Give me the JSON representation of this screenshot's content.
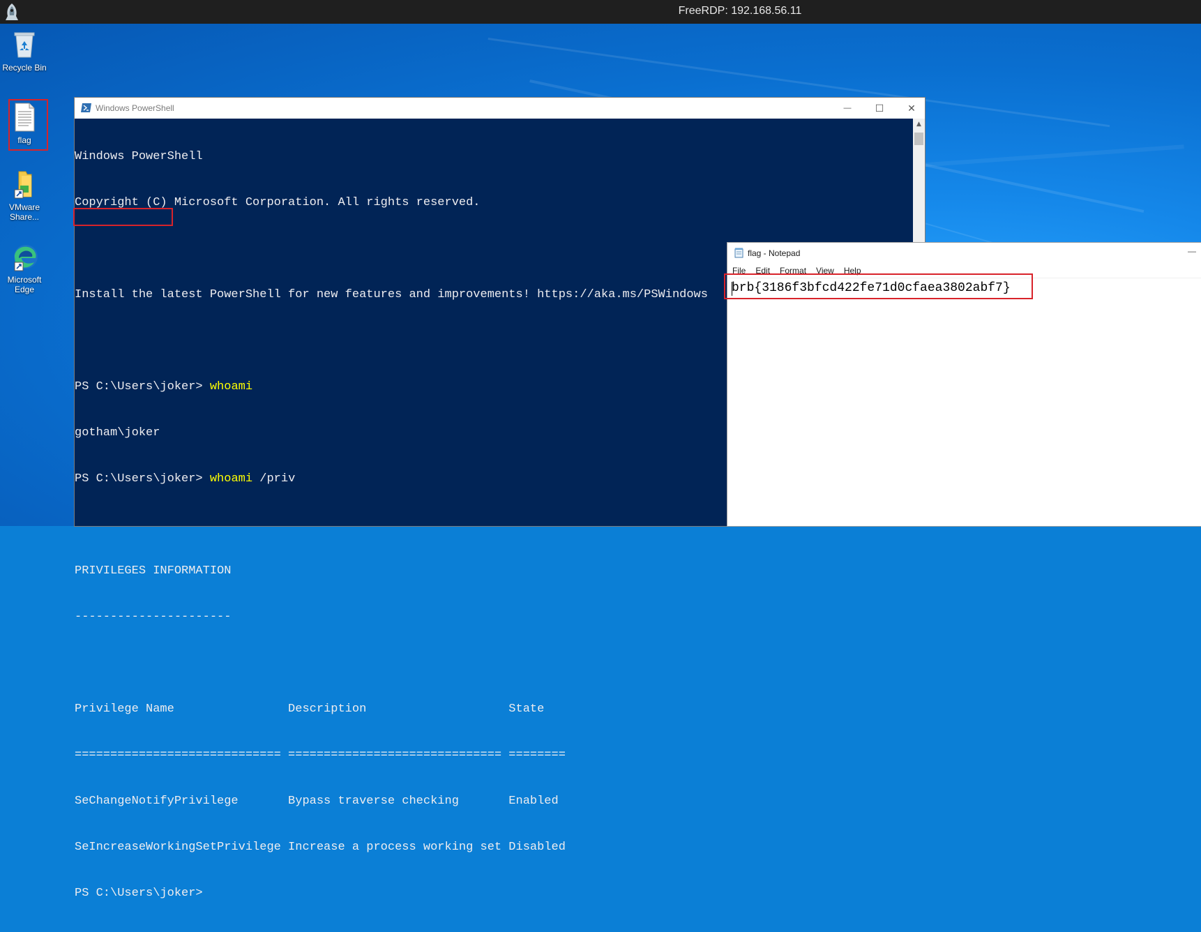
{
  "rdp": {
    "title": "FreeRDP: 192.168.56.11"
  },
  "desktop": {
    "icons": [
      {
        "label": "Recycle Bin"
      },
      {
        "label": "flag"
      },
      {
        "label": "VMware Share..."
      },
      {
        "label": "Microsoft Edge"
      }
    ]
  },
  "powershell": {
    "title": "Windows PowerShell",
    "controls": {
      "minimize": "—",
      "maximize": "☐",
      "close": "✕"
    },
    "lines": [
      {
        "plain": "Windows PowerShell"
      },
      {
        "plain": "Copyright (C) Microsoft Corporation. All rights reserved."
      },
      {
        "plain": ""
      },
      {
        "plain": "Install the latest PowerShell for new features and improvements! https://aka.ms/PSWindows"
      },
      {
        "plain": ""
      },
      {
        "prompt": "PS C:\\Users\\joker> ",
        "cmd": "whoami",
        "args": ""
      },
      {
        "plain": "gotham\\joker"
      },
      {
        "prompt": "PS C:\\Users\\joker> ",
        "cmd": "whoami",
        "args": " /priv"
      },
      {
        "plain": ""
      },
      {
        "plain": "PRIVILEGES INFORMATION"
      },
      {
        "plain": "----------------------"
      },
      {
        "plain": ""
      },
      {
        "plain": "Privilege Name                Description                    State"
      },
      {
        "plain": "============================= ============================== ========"
      },
      {
        "plain": "SeChangeNotifyPrivilege       Bypass traverse checking       Enabled"
      },
      {
        "plain": "SeIncreaseWorkingSetPrivilege Increase a process working set Disabled"
      },
      {
        "plain": "PS C:\\Users\\joker>"
      }
    ]
  },
  "notepad": {
    "title": "flag - Notepad",
    "menu": [
      "File",
      "Edit",
      "Format",
      "View",
      "Help"
    ],
    "content": "brb{3186f3bfcd422fe71d0cfaea3802abf7}",
    "close": "—"
  },
  "colors": {
    "ps_background": "#012456",
    "ps_command": "#ffff00",
    "highlight_box": "#d8232a"
  }
}
